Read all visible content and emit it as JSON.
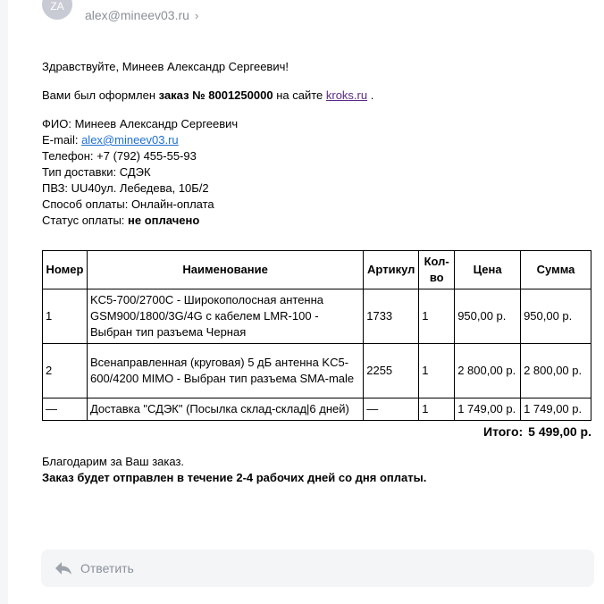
{
  "sender": {
    "initials": "ZA",
    "email": "alex@mineev03.ru",
    "chevron": "›"
  },
  "email": {
    "greeting": "Здравствуйте, Минеев Александр Сергеевич!",
    "order_line": {
      "prefix": "Вами был оформлен",
      "order": "заказ № 8001250000",
      "middle": "на сайте",
      "site": "kroks.ru",
      "suffix": "."
    },
    "details": [
      {
        "label": "ФИО:",
        "value": "Минеев Александр Сергеевич"
      },
      {
        "label": "E-mail:",
        "value": "alex@mineev03.ru",
        "link": true
      },
      {
        "label": "Телефон:",
        "value": "+7 (792) 455-55-93"
      },
      {
        "label": "Тип доставки:",
        "value": "СДЭК"
      },
      {
        "label": "ПВЗ:",
        "value": "UU40ул. Лебедева, 10Б/2"
      },
      {
        "label": "Способ оплаты:",
        "value": "Онлайн-оплата"
      },
      {
        "label": "Статус оплаты:",
        "value": "не оплачено",
        "bold": true
      }
    ],
    "table": {
      "headers": [
        "Номер",
        "Наименование",
        "Артикул",
        "Кол-во",
        "Цена",
        "Сумма"
      ],
      "rows": [
        [
          "1",
          "KC5-700/2700C - Широкополосная антенна GSM900/1800/3G/4G с кабелем LMR-100  -  Выбран тип разъема Черная",
          "1733",
          "1",
          "950,00 р.",
          "950,00 р."
        ],
        [
          "2",
          "Всенаправленная (круговая) 5 дБ антенна KC5-600/4200 MIMO  -  Выбран тип разъема SMA-male",
          "2255",
          "1",
          "2 800,00 р.",
          "2 800,00 р."
        ],
        [
          "—",
          "Доставка \"СДЭК\" (Посылка склад-склад|6 дней)",
          "—",
          "1",
          "1 749,00 р.",
          "1 749,00 р."
        ]
      ]
    },
    "total": {
      "label": "Итого:",
      "value": "5 499,00 р."
    },
    "thanks": "Благодарим за Ваш заказ.",
    "shipping_note": "Заказ будет отправлен в течение 2-4 рабочих дней со дня оплаты."
  },
  "reply": {
    "label": "Ответить",
    "icon": "reply-icon"
  }
}
